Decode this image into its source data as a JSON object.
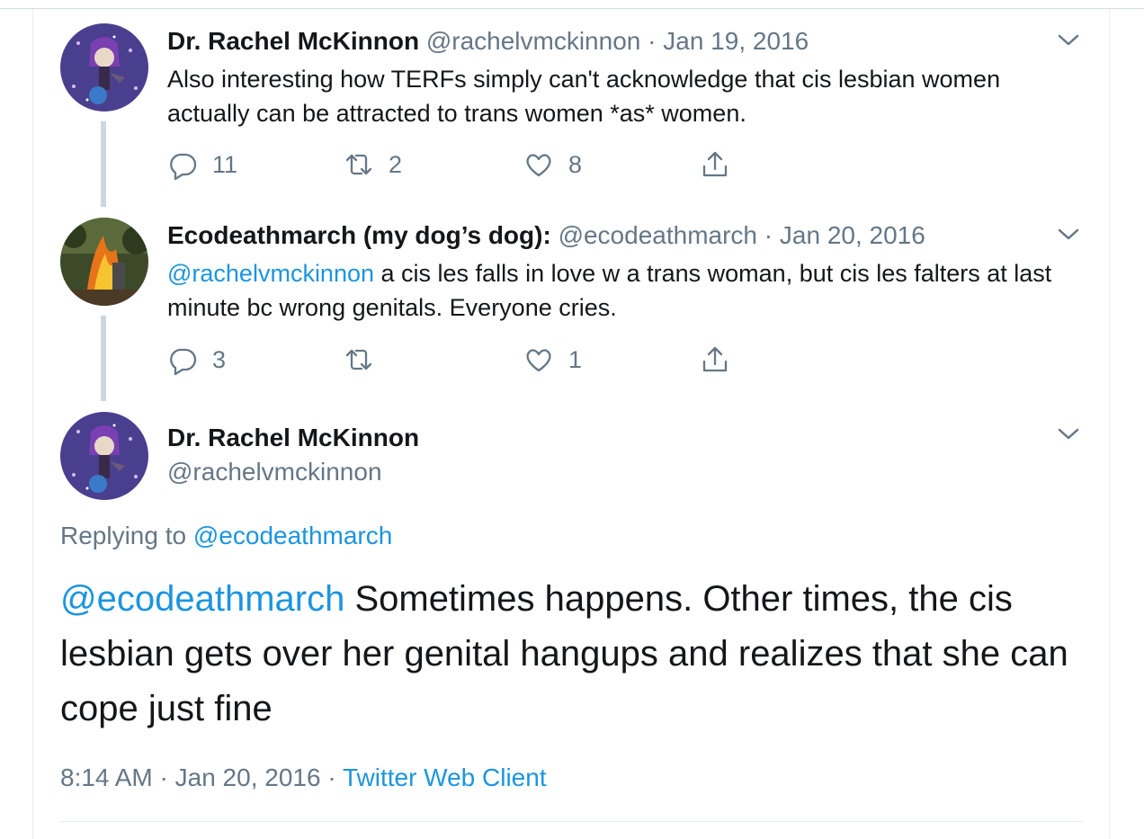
{
  "colors": {
    "link": "#1b95e0",
    "muted": "#657786",
    "text": "#14171a"
  },
  "tweets": [
    {
      "name": "Dr. Rachel McKinnon",
      "handle": "@rachelvmckinnon",
      "separator": "·",
      "date": "Jan 19, 2016",
      "text": "Also interesting how TERFs simply can't acknowledge that cis lesbian women actually can be attracted to trans women *as* women.",
      "replies": "11",
      "retweets": "2",
      "likes": "8"
    },
    {
      "name": "Ecodeathmarch (my dog’s dog):",
      "handle": "@ecodeathmarch",
      "separator": "·",
      "date": "Jan 20, 2016",
      "mention": "@rachelvmckinnon",
      "text": " a cis les falls in love w a trans woman, but cis les falters at last minute bc wrong genitals. Everyone cries.",
      "replies": "3",
      "retweets": "",
      "likes": "1"
    }
  ],
  "main_tweet": {
    "name": "Dr. Rachel McKinnon",
    "handle": "@rachelvmckinnon",
    "replying_label": "Replying to",
    "replying_handle": "@ecodeathmarch",
    "mention": "@ecodeathmarch",
    "text": " Sometimes happens. Other times, the cis lesbian gets over her genital hangups and realizes that she can cope just fine",
    "time": "8:14 AM",
    "separator": "·",
    "date": "Jan 20, 2016",
    "separator2": "·",
    "client": "Twitter Web Client"
  },
  "icons": [
    "reply-icon",
    "retweet-icon",
    "like-icon",
    "share-icon",
    "chevron-down-icon"
  ]
}
